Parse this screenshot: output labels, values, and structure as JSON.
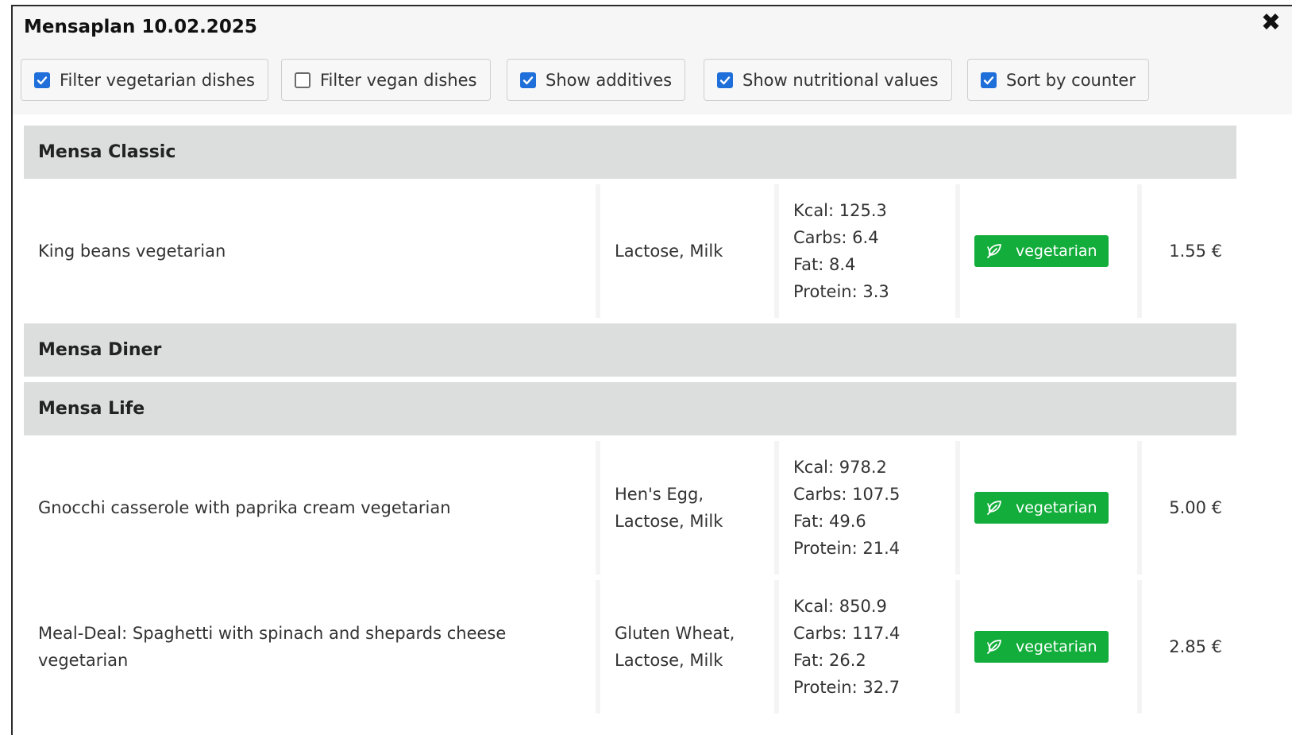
{
  "dialog": {
    "title": "Mensaplan 10.02.2025",
    "close_glyph": "✖"
  },
  "filters": [
    {
      "label": "Filter vegetarian dishes",
      "checked": true
    },
    {
      "label": "Filter vegan dishes",
      "checked": false
    },
    {
      "label": "Show additives",
      "checked": true
    },
    {
      "label": "Show nutritional values",
      "checked": true
    },
    {
      "label": "Sort by counter",
      "checked": true
    }
  ],
  "counters": [
    {
      "name": "Mensa Classic",
      "dishes": [
        {
          "name": "King beans vegetarian",
          "additives": "Lactose, Milk",
          "kcal": "Kcal: 125.3",
          "carbs": "Carbs: 6.4",
          "fat": "Fat: 8.4",
          "protein": "Protein: 3.3",
          "tag": "vegetarian",
          "price": "1.55 €"
        }
      ]
    },
    {
      "name": "Mensa Diner",
      "dishes": []
    },
    {
      "name": "Mensa Life",
      "dishes": [
        {
          "name": "Gnocchi casserole with paprika cream vegetarian",
          "additives": "Hen's Egg, Lactose, Milk",
          "kcal": "Kcal: 978.2",
          "carbs": "Carbs: 107.5",
          "fat": "Fat: 49.6",
          "protein": "Protein: 21.4",
          "tag": "vegetarian",
          "price": "5.00 €"
        },
        {
          "name": "Meal-Deal: Spaghetti with spinach and shepards cheese vegetarian",
          "additives": "Gluten Wheat, Lactose, Milk",
          "kcal": "Kcal: 850.9",
          "carbs": "Carbs: 117.4",
          "fat": "Fat: 26.2",
          "protein": "Protein: 32.7",
          "tag": "vegetarian",
          "price": "2.85 €"
        }
      ]
    }
  ],
  "colors": {
    "checkbox_accent": "#1e6fd9",
    "vegetarian_badge": "#12ad3a",
    "counter_header": "#dcdddd"
  },
  "icons": {
    "close": "close-icon",
    "vegetarian": "leaf-icon",
    "checkbox_checked": "checkmark-icon"
  }
}
